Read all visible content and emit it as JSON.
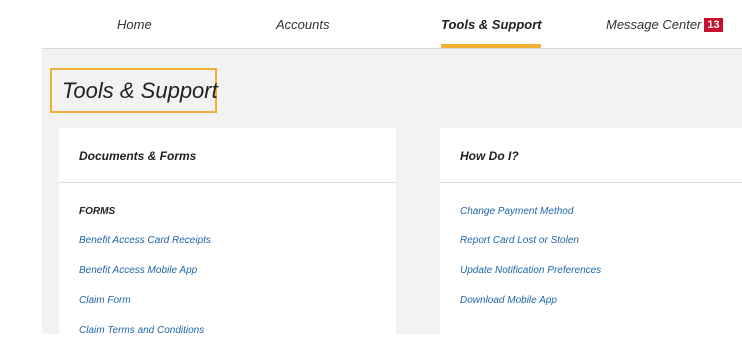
{
  "nav": {
    "items": [
      {
        "label": "Home"
      },
      {
        "label": "Accounts"
      },
      {
        "label": "Tools & Support"
      },
      {
        "label": "Message Center"
      }
    ],
    "message_count": "13",
    "active_color": "#f2b135",
    "badge_color": "#c8102e"
  },
  "page": {
    "title": "Tools & Support"
  },
  "documents": {
    "title": "Documents & Forms",
    "section_label": "FORMS",
    "links": [
      "Benefit Access Card Receipts",
      "Benefit Access Mobile App",
      "Claim Form",
      "Claim Terms and Conditions"
    ]
  },
  "how_do_i": {
    "title": "How Do I?",
    "links": [
      "Change Payment Method",
      "Report Card Lost or Stolen",
      "Update Notification Preferences",
      "Download Mobile App"
    ]
  },
  "colors": {
    "link": "#1f65a8",
    "accent": "#f2b135",
    "background": "#f2f2f2"
  }
}
